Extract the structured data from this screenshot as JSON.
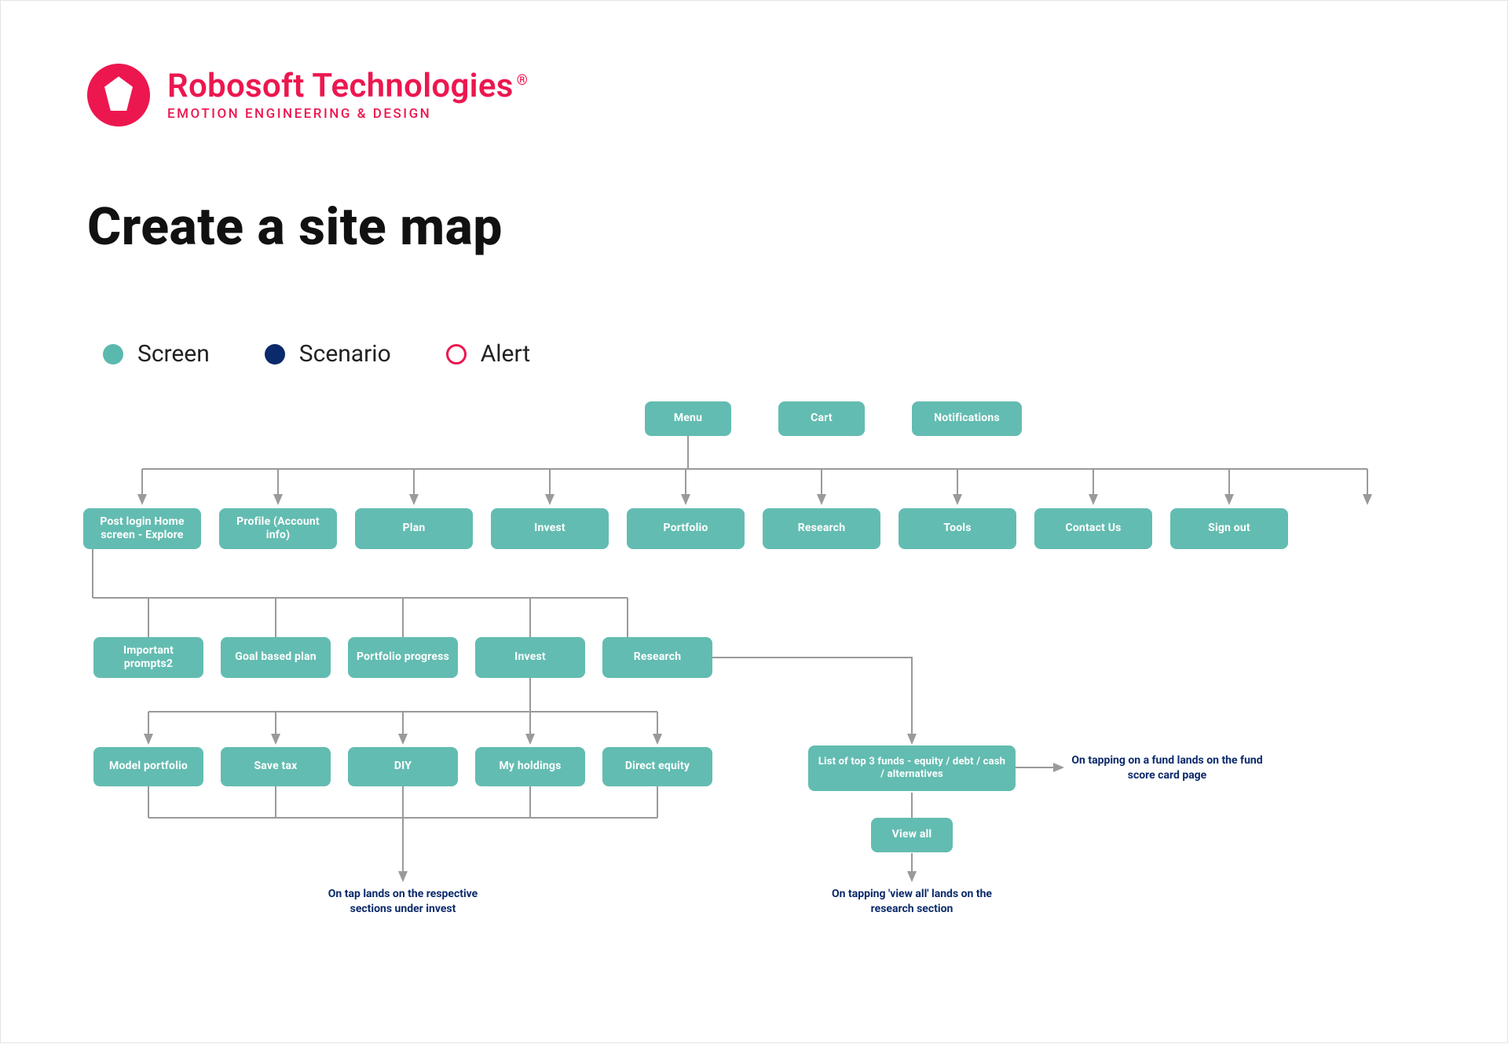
{
  "brand": {
    "name": "Robosoft Technologies",
    "tagline": "EMOTION ENGINEERING & DESIGN",
    "registered": "®"
  },
  "title": "Create a site map",
  "legend": {
    "screen": "Screen",
    "scenario": "Scenario",
    "alert": "Alert"
  },
  "colors": {
    "teal": "#63BCB1",
    "navy": "#0B2A6B",
    "brand": "#EC174F"
  },
  "nodes": {
    "menu": "Menu",
    "cart": "Cart",
    "notifications": "Notifications",
    "post_login": "Post login Home screen - Explore",
    "profile": "Profile (Account info)",
    "plan": "Plan",
    "invest_top": "Invest",
    "portfolio": "Portfolio",
    "research_top": "Research",
    "tools": "Tools",
    "contact": "Contact Us",
    "signout": "Sign out",
    "important_prompts": "Important prompts2",
    "goal_plan": "Goal based plan",
    "portfolio_progress": "Portfolio progress",
    "invest_mid": "Invest",
    "research_mid": "Research",
    "model_portfolio": "Model portfolio",
    "save_tax": "Save tax",
    "diy": "DIY",
    "my_holdings": "My holdings",
    "direct_equity": "Direct equity",
    "top3": "List of top 3 funds - equity / debt / cash / alternatives",
    "view_all": "View all"
  },
  "notes": {
    "invest_note": "On tap lands on the respective sections under invest",
    "research_note": "On tapping 'view all' lands on the research section",
    "fund_note": "On tapping on a fund lands on the fund score card page"
  }
}
